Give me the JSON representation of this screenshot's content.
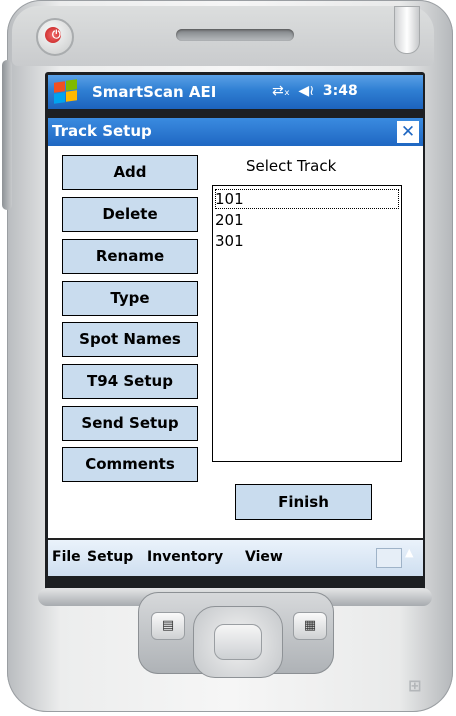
{
  "titlebar": {
    "app_name": "SmartScan AEI",
    "time": "3:48",
    "connectivity_icon": "connectivity-icon",
    "volume_icon": "volume-icon"
  },
  "window": {
    "title": "Track Setup",
    "close_label": "✕"
  },
  "buttons": {
    "add": "Add",
    "delete": "Delete",
    "rename": "Rename",
    "type": "Type",
    "spot_names": "Spot Names",
    "t94_setup": "T94 Setup",
    "send_setup": "Send Setup",
    "comments": "Comments"
  },
  "track_list": {
    "label": "Select Track",
    "items": [
      "101",
      "201",
      "301"
    ],
    "selected_index": 0
  },
  "finish_label": "Finish",
  "menu": {
    "items": [
      "File",
      "Setup",
      "Inventory",
      "View"
    ]
  },
  "colors": {
    "titlebar_blue": "#2f7fd3",
    "button_fill": "#c9dcee",
    "power_red": "#c51d1d"
  }
}
